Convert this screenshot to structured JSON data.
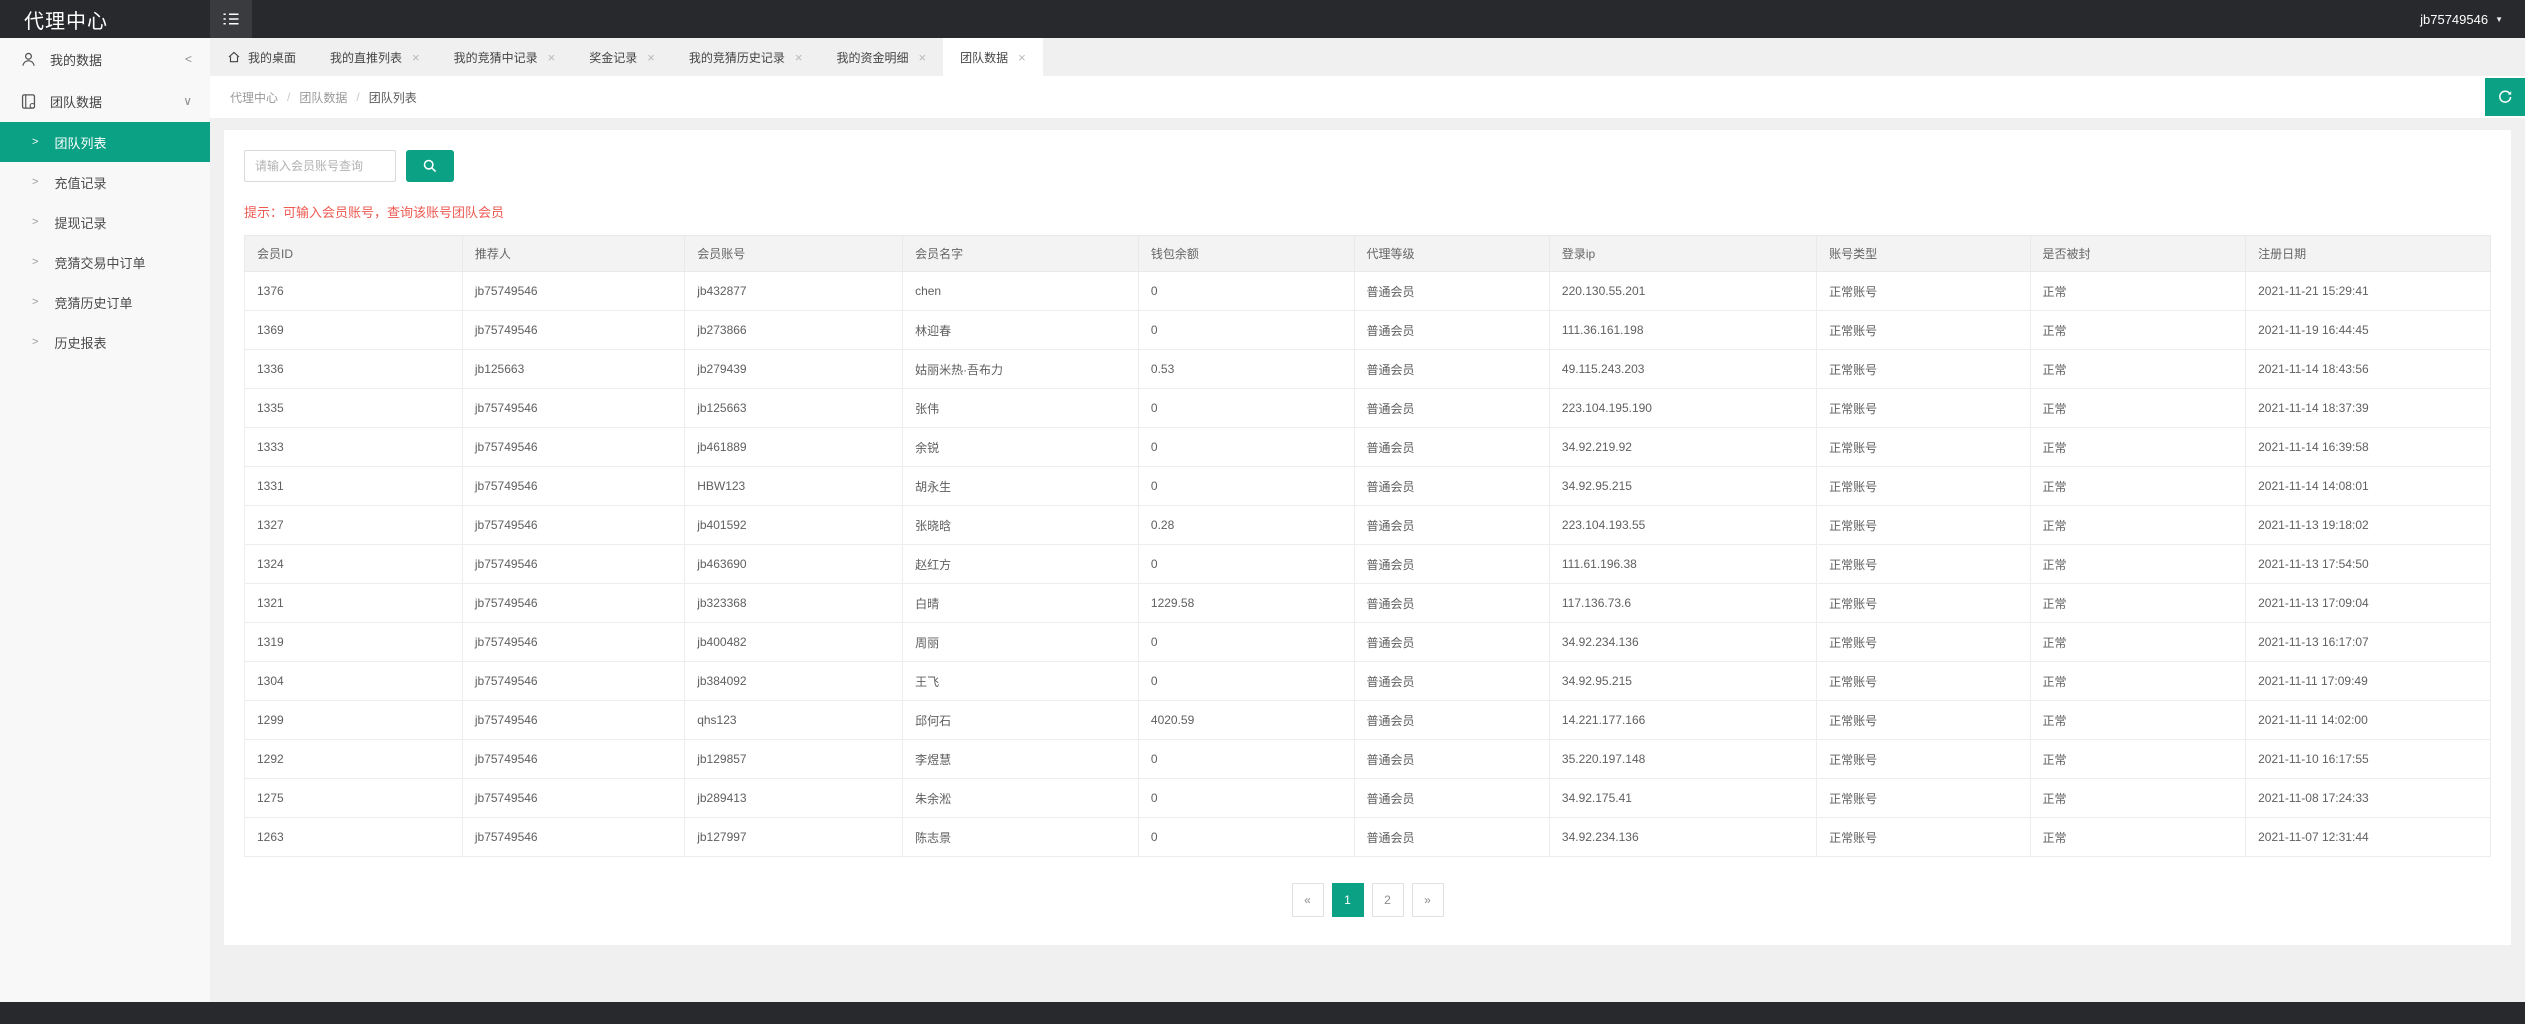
{
  "header": {
    "title": "代理中心",
    "username": "jb75749546"
  },
  "glyphs": {
    "close": "×",
    "collapsed": "<",
    "expanded": "∨",
    "sub_arrow": ">",
    "caret": "▼",
    "crumb_sep": "/"
  },
  "colors": {
    "accent": "#0aa184",
    "header_bg": "#28292c",
    "hint_red": "#ee5a52",
    "sidebar_bg": "#f8f8f8",
    "page_bg": "#f0f0f0"
  },
  "sidebar": {
    "groups": [
      {
        "label": "我的数据",
        "icon": "user-icon",
        "state": "collapsed"
      },
      {
        "label": "团队数据",
        "icon": "team-data-icon",
        "state": "expanded",
        "children": [
          {
            "label": "团队列表",
            "active": true
          },
          {
            "label": "充值记录",
            "active": false
          },
          {
            "label": "提现记录",
            "active": false
          },
          {
            "label": "竞猜交易中订单",
            "active": false
          },
          {
            "label": "竞猜历史订单",
            "active": false
          },
          {
            "label": "历史报表",
            "active": false
          }
        ]
      }
    ]
  },
  "tabs": [
    {
      "label": "我的桌面",
      "home": true,
      "closable": false,
      "active": false
    },
    {
      "label": "我的直推列表",
      "home": false,
      "closable": true,
      "active": false
    },
    {
      "label": "我的竞猜中记录",
      "home": false,
      "closable": true,
      "active": false
    },
    {
      "label": "奖金记录",
      "home": false,
      "closable": true,
      "active": false
    },
    {
      "label": "我的竞猜历史记录",
      "home": false,
      "closable": true,
      "active": false
    },
    {
      "label": "我的资金明细",
      "home": false,
      "closable": true,
      "active": false
    },
    {
      "label": "团队数据",
      "home": false,
      "closable": true,
      "active": true
    }
  ],
  "breadcrumb": [
    "代理中心",
    "团队数据",
    "团队列表"
  ],
  "search": {
    "placeholder": "请输入会员账号查询"
  },
  "hint": "提示：可输入会员账号，查询该账号团队会员",
  "table": {
    "columns": [
      "会员ID",
      "推荐人",
      "会员账号",
      "会员名字",
      "钱包余额",
      "代理等级",
      "登录ip",
      "账号类型",
      "是否被封",
      "注册日期"
    ],
    "rows": [
      [
        "1376",
        "jb75749546",
        "jb432877",
        "chen",
        "0",
        "普通会员",
        "220.130.55.201",
        "正常账号",
        "正常",
        "2021-11-21 15:29:41"
      ],
      [
        "1369",
        "jb75749546",
        "jb273866",
        "林迎春",
        "0",
        "普通会员",
        "111.36.161.198",
        "正常账号",
        "正常",
        "2021-11-19 16:44:45"
      ],
      [
        "1336",
        "jb125663",
        "jb279439",
        "姑丽米热·吾布力",
        "0.53",
        "普通会员",
        "49.115.243.203",
        "正常账号",
        "正常",
        "2021-11-14 18:43:56"
      ],
      [
        "1335",
        "jb75749546",
        "jb125663",
        "张伟",
        "0",
        "普通会员",
        "223.104.195.190",
        "正常账号",
        "正常",
        "2021-11-14 18:37:39"
      ],
      [
        "1333",
        "jb75749546",
        "jb461889",
        "余锐",
        "0",
        "普通会员",
        "34.92.219.92",
        "正常账号",
        "正常",
        "2021-11-14 16:39:58"
      ],
      [
        "1331",
        "jb75749546",
        "HBW123",
        "胡永生",
        "0",
        "普通会员",
        "34.92.95.215",
        "正常账号",
        "正常",
        "2021-11-14 14:08:01"
      ],
      [
        "1327",
        "jb75749546",
        "jb401592",
        "张晓晗",
        "0.28",
        "普通会员",
        "223.104.193.55",
        "正常账号",
        "正常",
        "2021-11-13 19:18:02"
      ],
      [
        "1324",
        "jb75749546",
        "jb463690",
        "赵红方",
        "0",
        "普通会员",
        "111.61.196.38",
        "正常账号",
        "正常",
        "2021-11-13 17:54:50"
      ],
      [
        "1321",
        "jb75749546",
        "jb323368",
        "白晴",
        "1229.58",
        "普通会员",
        "117.136.73.6",
        "正常账号",
        "正常",
        "2021-11-13 17:09:04"
      ],
      [
        "1319",
        "jb75749546",
        "jb400482",
        "周丽",
        "0",
        "普通会员",
        "34.92.234.136",
        "正常账号",
        "正常",
        "2021-11-13 16:17:07"
      ],
      [
        "1304",
        "jb75749546",
        "jb384092",
        "王飞",
        "0",
        "普通会员",
        "34.92.95.215",
        "正常账号",
        "正常",
        "2021-11-11 17:09:49"
      ],
      [
        "1299",
        "jb75749546",
        "qhs123",
        "邱何石",
        "4020.59",
        "普通会员",
        "14.221.177.166",
        "正常账号",
        "正常",
        "2021-11-11 14:02:00"
      ],
      [
        "1292",
        "jb75749546",
        "jb129857",
        "李煜慧",
        "0",
        "普通会员",
        "35.220.197.148",
        "正常账号",
        "正常",
        "2021-11-10 16:17:55"
      ],
      [
        "1275",
        "jb75749546",
        "jb289413",
        "朱余淞",
        "0",
        "普通会员",
        "34.92.175.41",
        "正常账号",
        "正常",
        "2021-11-08 17:24:33"
      ],
      [
        "1263",
        "jb75749546",
        "jb127997",
        "陈志景",
        "0",
        "普通会员",
        "34.92.234.136",
        "正常账号",
        "正常",
        "2021-11-07 12:31:44"
      ]
    ]
  },
  "pagination": {
    "prev": "«",
    "pages": [
      "1",
      "2"
    ],
    "active": "1",
    "next": "»"
  }
}
